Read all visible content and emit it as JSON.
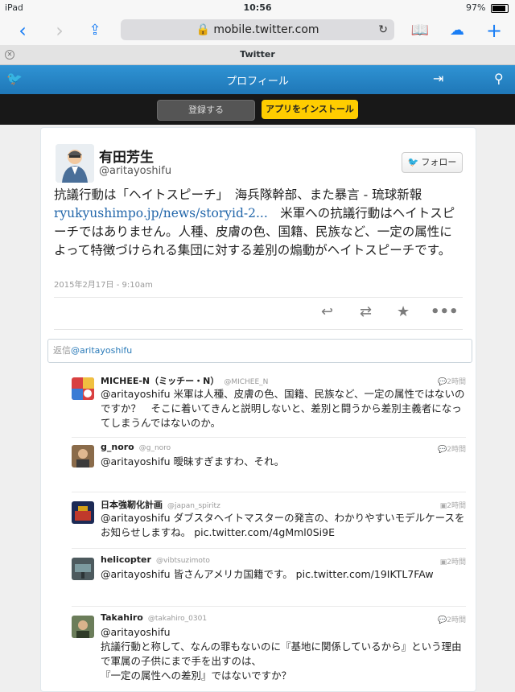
{
  "status": {
    "device": "iPad",
    "time": "10:56",
    "battery": "97%",
    "battery_level": 0.97
  },
  "browser": {
    "url": "mobile.twitter.com",
    "tab_title": "Twitter"
  },
  "twitter_bar": {
    "title": "プロフィール"
  },
  "action_bar": {
    "login": "登録する",
    "install": "アプリをインストール"
  },
  "profile": {
    "name": "有田芳生",
    "handle": "@aritayoshifu",
    "follow": "フォロー"
  },
  "tweet": {
    "text_part1": "抗議行動は「ヘイトスピーチ」　海兵隊幹部、また暴言 - 琉球新報",
    "link": "ryukyushimpo.jp/news/storyid-2...",
    "text_part2": "　米軍への抗議行動はヘイトスピーチではありません。人種、皮膚の色、国籍、民族など、一定の属性によって特徴づけられる集団に対する差別の煽動がヘイトスピーチです。",
    "date": "2015年2月17日 - 9:10am"
  },
  "reply_box": {
    "prefix": "返信",
    "target": "@aritayoshifu"
  },
  "replies": [
    {
      "name": "MICHEE-N（ミッチー・N）",
      "handle": "@MICHEE_N",
      "time": "2時間",
      "body": "@aritayoshifu 米軍は人種、皮膚の色、国籍、民族など、一定の属性ではないのですか？　そこに着いてきんと説明しないと、差別と闘うから差別主義者になってしまうんではないのか。"
    },
    {
      "name": "g_noro",
      "handle": "@g_noro",
      "time": "2時間",
      "body": "@aritayoshifu 曖昧すぎますわ、それ。"
    },
    {
      "name": "日本強靭化計画",
      "handle": "@japan_spiritz",
      "time": "2時間",
      "body": "@aritayoshifu ダブスタヘイトマスターの発言の、わかりやすいモデルケースをお知らせしますね。 pic.twitter.com/4gMml0Si9E"
    },
    {
      "name": "helicopter",
      "handle": "@vibtsuzimoto",
      "time": "2時間",
      "body": "@aritayoshifu 皆さんアメリカ国籍です。 pic.twitter.com/19IKTL7FAw"
    },
    {
      "name": "Takahiro",
      "handle": "@takahiro_0301",
      "time": "2時間",
      "body": "@aritayoshifu\n抗議行動と称して、なんの罪もないのに『基地に関係しているから』という理由で軍属の子供にまで手を出すのは、\n『一定の属性への差別』ではないですか？"
    }
  ]
}
